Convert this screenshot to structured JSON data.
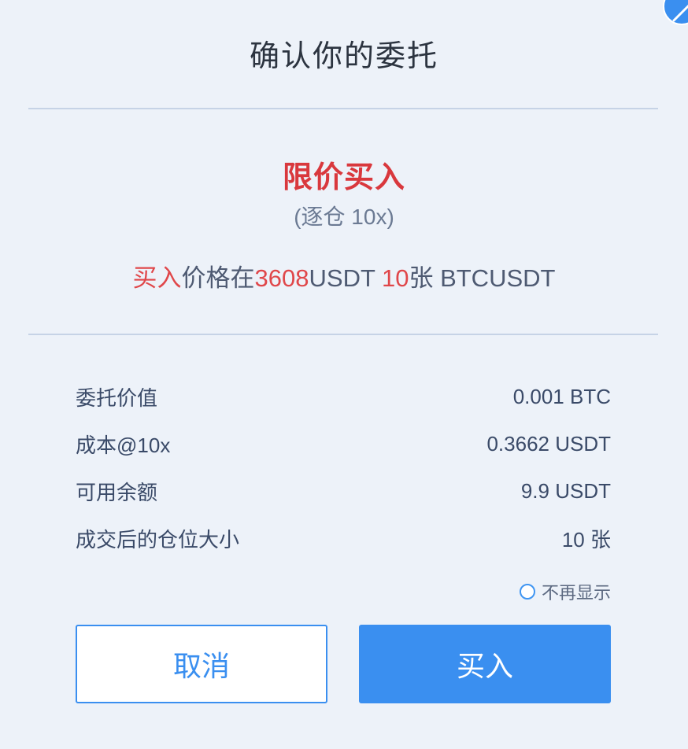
{
  "dialog": {
    "title": "确认你的委托",
    "order_type": "限价买入",
    "margin_mode": "(逐仓 10x)",
    "summary": {
      "action": "买入",
      "price_prefix": "价格在",
      "price": "3608",
      "price_unit": "USDT ",
      "quantity": "10",
      "quantity_unit": "张 BTCUSDT"
    },
    "details": [
      {
        "label": "委托价值",
        "value": "0.001 BTC"
      },
      {
        "label": "成本@10x",
        "value": "0.3662 USDT"
      },
      {
        "label": "可用余额",
        "value": "9.9 USDT"
      },
      {
        "label": "成交后的仓位大小",
        "value": "10 张"
      }
    ],
    "dont_show_again": "不再显示",
    "cancel_label": "取消",
    "confirm_label": "买入"
  },
  "icons": {
    "close": "close-icon"
  },
  "colors": {
    "accent": "#3a8ff0",
    "buy_red": "#d9383d",
    "background": "#edf2f9"
  }
}
